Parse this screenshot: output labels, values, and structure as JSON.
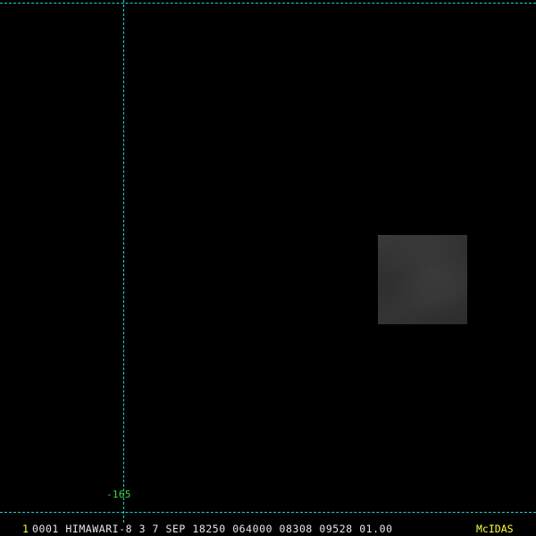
{
  "colors": {
    "background": "#000000",
    "gridline": "#19d3d3",
    "meridian_label": "#3cdc3c",
    "frame_number": "#ffff33",
    "frame_info": "#e6e6e6",
    "brand": "#ffff33",
    "image_patch": "#333333"
  },
  "map": {
    "meridian_label": "-165"
  },
  "status_bar": {
    "frame_number": "1",
    "frame_info": "0001 HIMAWARI-8   3   7 SEP 18250 064000 08308 09528 01.00",
    "brand": "McIDAS"
  }
}
